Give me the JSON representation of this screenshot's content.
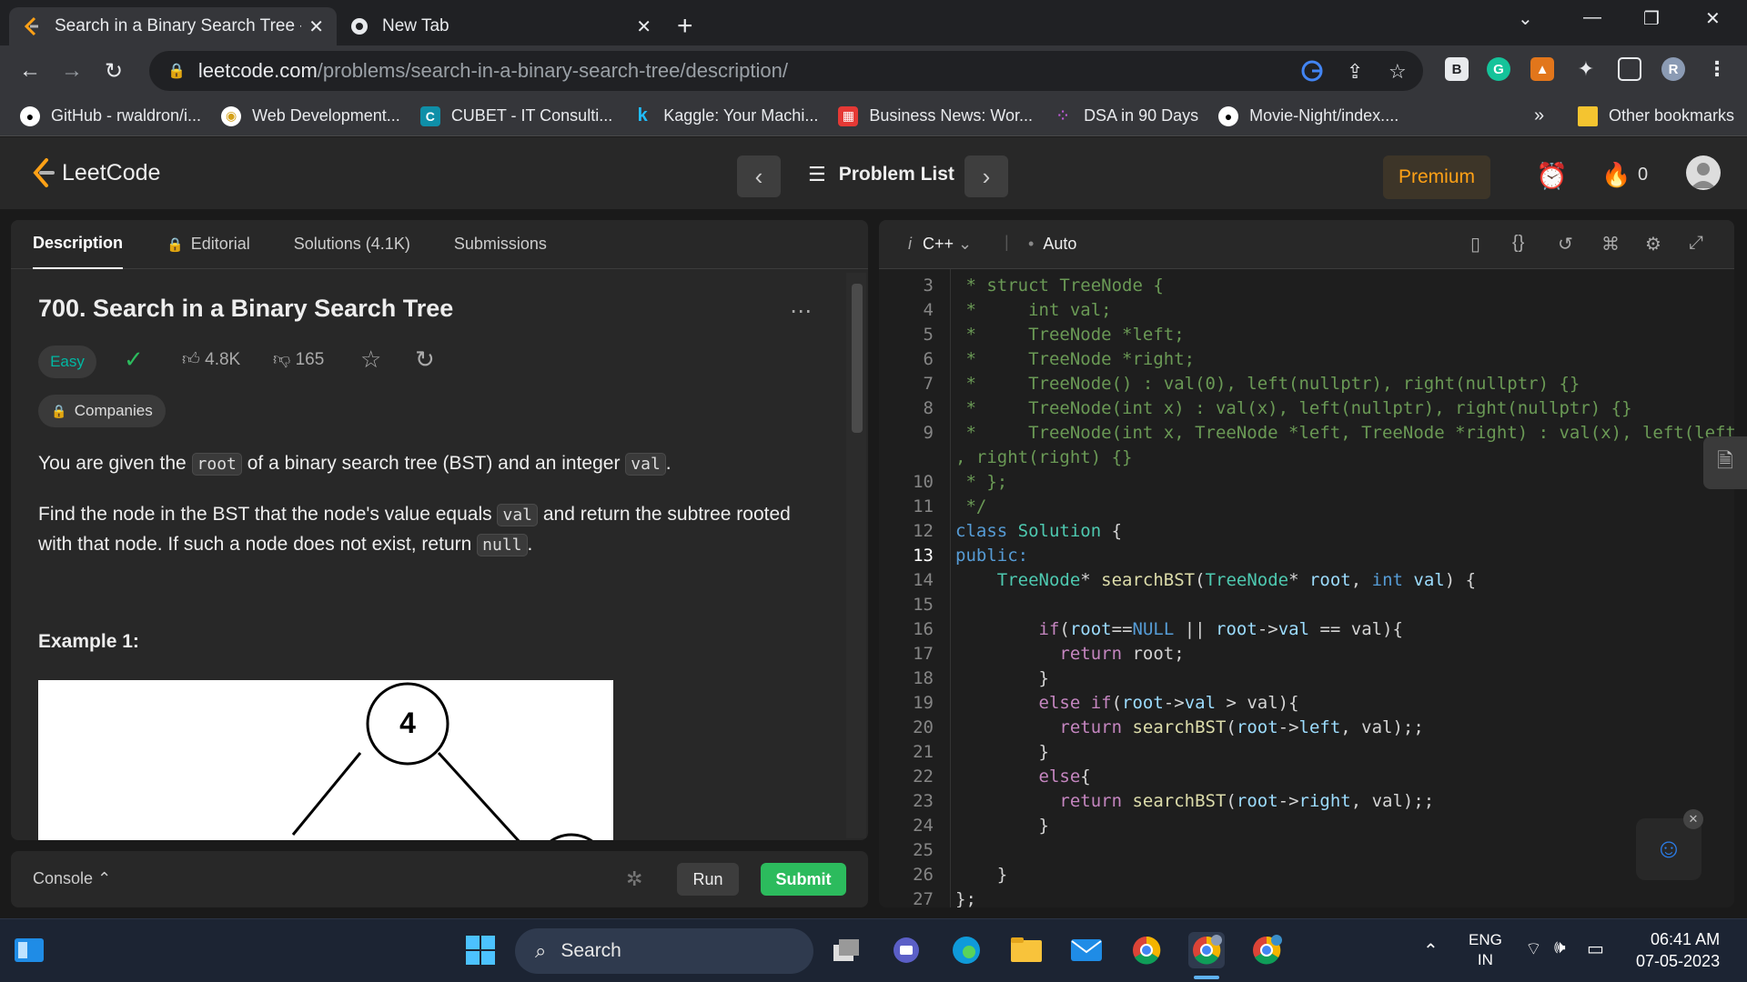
{
  "browser": {
    "tabs": [
      {
        "title": "Search in a Binary Search Tree - L",
        "active": true
      },
      {
        "title": "New Tab",
        "active": false
      }
    ],
    "url_host": "leetcode.com",
    "url_path": "/problems/search-in-a-binary-search-tree/description/",
    "bookmarks": [
      {
        "label": "GitHub - rwaldron/i...",
        "icon": "github-icon"
      },
      {
        "label": "Web Development...",
        "icon": "web-dev-icon"
      },
      {
        "label": "CUBET - IT Consulti...",
        "icon": "cubet-icon"
      },
      {
        "label": "Kaggle: Your Machi...",
        "icon": "kaggle-icon"
      },
      {
        "label": "Business News: Wor...",
        "icon": "business-news-icon"
      },
      {
        "label": "DSA in 90 Days",
        "icon": "dsa-icon"
      },
      {
        "label": "Movie-Night/index....",
        "icon": "github-icon"
      }
    ],
    "overflow": "»",
    "other_bookmarks": "Other bookmarks",
    "profile_initial": "R"
  },
  "leetcode": {
    "logo_text": "LeetCode",
    "problem_list": "Problem List",
    "premium": "Premium",
    "streak_count": "0"
  },
  "left": {
    "tabs": [
      "Description",
      "Editorial",
      "Solutions (4.1K)",
      "Submissions"
    ],
    "title": "700. Search in a Binary Search Tree",
    "difficulty": "Easy",
    "likes": "4.8K",
    "dislikes": "165",
    "companies": "Companies",
    "p1_a": "You are given the ",
    "p1_code1": "root",
    "p1_b": " of a binary search tree (BST) and an integer ",
    "p1_code2": "val",
    "p1_c": ".",
    "p2_a": "Find the node in the BST that the node's value equals ",
    "p2_code1": "val",
    "p2_b": " and return the subtree rooted",
    "p2_c": "with that node. If such a node does not exist, return ",
    "p2_code2": "null",
    "p2_d": ".",
    "example_heading": "Example 1:",
    "tree_root_value": "4"
  },
  "console": {
    "label": "Console",
    "run": "Run",
    "submit": "Submit"
  },
  "editor": {
    "lang_prefix": "i",
    "language": "C++",
    "mode": "Auto",
    "lines": [
      {
        "n": "3",
        "t": [
          [
            "c-cm",
            " * struct TreeNode {"
          ]
        ]
      },
      {
        "n": "4",
        "t": [
          [
            "c-cm",
            " *     int val;"
          ]
        ]
      },
      {
        "n": "5",
        "t": [
          [
            "c-cm",
            " *     TreeNode *left;"
          ]
        ]
      },
      {
        "n": "6",
        "t": [
          [
            "c-cm",
            " *     TreeNode *right;"
          ]
        ]
      },
      {
        "n": "7",
        "t": [
          [
            "c-cm",
            " *     TreeNode() : val(0), left(nullptr), right(nullptr) {}"
          ]
        ]
      },
      {
        "n": "8",
        "t": [
          [
            "c-cm",
            " *     TreeNode(int x) : val(x), left(nullptr), right(nullptr) {}"
          ]
        ]
      },
      {
        "n": "9",
        "t": [
          [
            "c-cm",
            " *     TreeNode(int x, TreeNode *left, TreeNode *right) : val(x), left(left)"
          ]
        ]
      },
      {
        "n": "",
        "t": [
          [
            "c-cm",
            ", right(right) {}"
          ]
        ]
      },
      {
        "n": "10",
        "t": [
          [
            "c-cm",
            " * };"
          ]
        ]
      },
      {
        "n": "11",
        "t": [
          [
            "c-cm",
            " */"
          ]
        ]
      },
      {
        "n": "12",
        "t": [
          [
            "c-kw",
            "class "
          ],
          [
            "c-ty",
            "Solution"
          ],
          [
            "c-pl",
            " {"
          ]
        ]
      },
      {
        "n": "13",
        "t": [
          [
            "c-kw",
            "public:"
          ]
        ]
      },
      {
        "n": "14",
        "t": [
          [
            "c-pl",
            "    "
          ],
          [
            "c-ty",
            "TreeNode"
          ],
          [
            "c-pl",
            "* "
          ],
          [
            "c-fn",
            "searchBST"
          ],
          [
            "c-pl",
            "("
          ],
          [
            "c-ty",
            "TreeNode"
          ],
          [
            "c-pl",
            "* "
          ],
          [
            "c-vr",
            "root"
          ],
          [
            "c-pl",
            ", "
          ],
          [
            "c-kw",
            "int "
          ],
          [
            "c-vr",
            "val"
          ],
          [
            "c-pl",
            ") {"
          ]
        ]
      },
      {
        "n": "15",
        "t": [
          [
            "c-pl",
            ""
          ]
        ]
      },
      {
        "n": "16",
        "t": [
          [
            "c-pl",
            "        "
          ],
          [
            "c-ctl",
            "if"
          ],
          [
            "c-pl",
            "("
          ],
          [
            "c-vr",
            "root"
          ],
          [
            "c-pl",
            "=="
          ],
          [
            "c-kw",
            "NULL"
          ],
          [
            "c-pl",
            " || "
          ],
          [
            "c-vr",
            "root"
          ],
          [
            "c-pl",
            "->"
          ],
          [
            "c-vr",
            "val"
          ],
          [
            "c-pl",
            " == val){"
          ]
        ]
      },
      {
        "n": "17",
        "t": [
          [
            "c-pl",
            "          "
          ],
          [
            "c-ctl",
            "return "
          ],
          [
            "c-pl",
            "root;"
          ]
        ]
      },
      {
        "n": "18",
        "t": [
          [
            "c-pl",
            "        }"
          ]
        ]
      },
      {
        "n": "19",
        "t": [
          [
            "c-pl",
            "        "
          ],
          [
            "c-ctl",
            "else if"
          ],
          [
            "c-pl",
            "("
          ],
          [
            "c-vr",
            "root"
          ],
          [
            "c-pl",
            "->"
          ],
          [
            "c-vr",
            "val"
          ],
          [
            "c-pl",
            " > val){"
          ]
        ]
      },
      {
        "n": "20",
        "t": [
          [
            "c-pl",
            "          "
          ],
          [
            "c-ctl",
            "return "
          ],
          [
            "c-fn",
            "searchBST"
          ],
          [
            "c-pl",
            "("
          ],
          [
            "c-vr",
            "root"
          ],
          [
            "c-pl",
            "->"
          ],
          [
            "c-vr",
            "left"
          ],
          [
            "c-pl",
            ", val);;"
          ]
        ]
      },
      {
        "n": "21",
        "t": [
          [
            "c-pl",
            "        }"
          ]
        ]
      },
      {
        "n": "22",
        "t": [
          [
            "c-pl",
            "        "
          ],
          [
            "c-ctl",
            "else"
          ],
          [
            "c-pl",
            "{"
          ]
        ]
      },
      {
        "n": "23",
        "t": [
          [
            "c-pl",
            "          "
          ],
          [
            "c-ctl",
            "return "
          ],
          [
            "c-fn",
            "searchBST"
          ],
          [
            "c-pl",
            "("
          ],
          [
            "c-vr",
            "root"
          ],
          [
            "c-pl",
            "->"
          ],
          [
            "c-vr",
            "right"
          ],
          [
            "c-pl",
            ", val);;"
          ]
        ]
      },
      {
        "n": "24",
        "t": [
          [
            "c-pl",
            "        }"
          ]
        ]
      },
      {
        "n": "25",
        "t": [
          [
            "c-pl",
            ""
          ]
        ]
      },
      {
        "n": "26",
        "t": [
          [
            "c-pl",
            "    }"
          ]
        ]
      },
      {
        "n": "27",
        "t": [
          [
            "c-pl",
            "};"
          ]
        ]
      }
    ]
  },
  "taskbar": {
    "search": "Search",
    "lang_top": "ENG",
    "lang_bottom": "IN",
    "time": "06:41 AM",
    "date": "07-05-2023"
  },
  "colors": {
    "accent_green": "#2cbb5d",
    "premium_orange": "#ffa116",
    "easy_teal": "#00b8a3"
  }
}
